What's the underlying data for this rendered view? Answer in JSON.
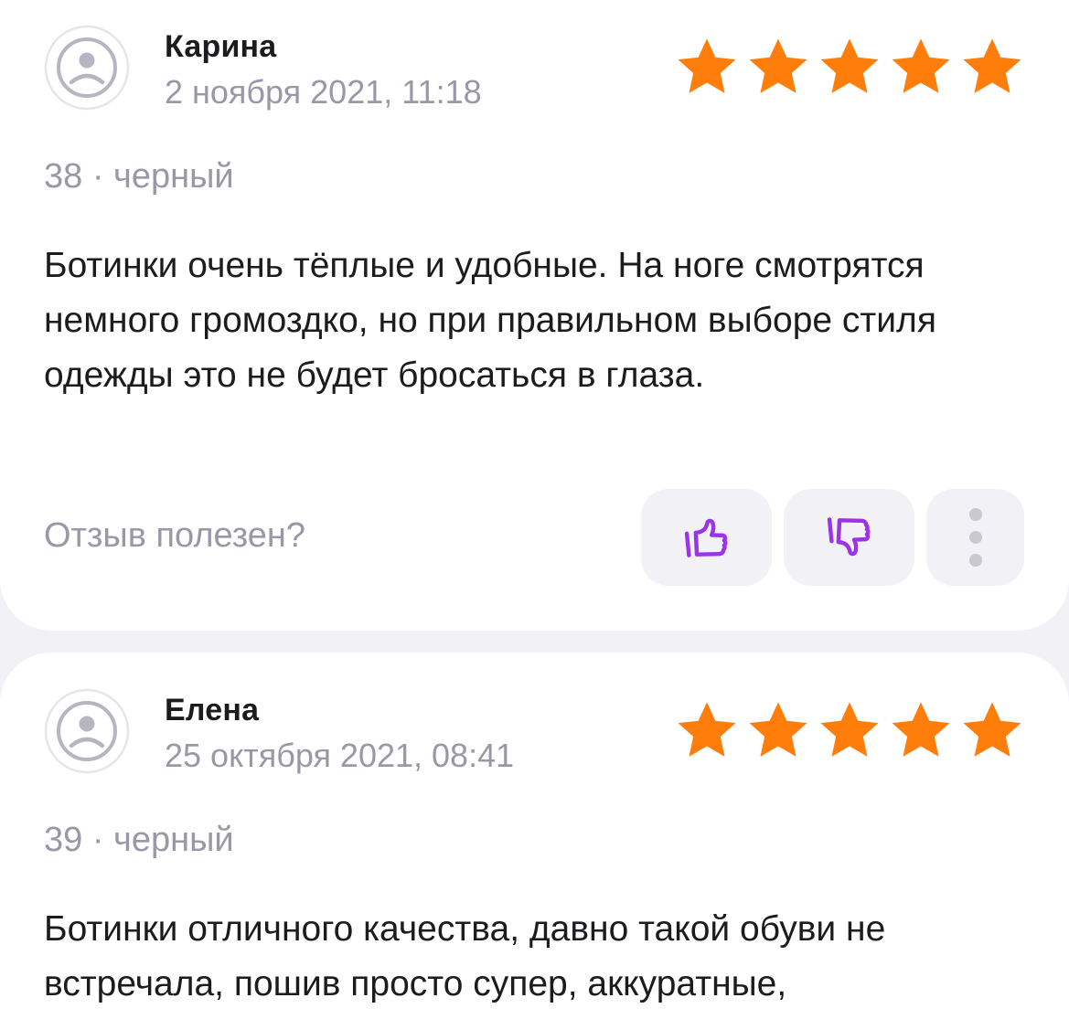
{
  "colors": {
    "star": "#ff7d0a",
    "accent": "#9b34e8",
    "muted_text": "#9a98a6",
    "text": "#1c1c1e",
    "background": "#f2f2f6"
  },
  "reviews": [
    {
      "author": "Карина",
      "date": "2 ноября 2021, 11:18",
      "rating": 5,
      "variant": "38 · черный",
      "text": "Ботинки очень тёплые и удобные. На ноге смотрятся немного громоздко, но при правильном выборе стиля одежды это не будет бросаться в глаза.",
      "helpful_label": "Отзыв полезен?",
      "avatar_icon": "sad-face-icon",
      "like_icon": "thumbs-up-icon",
      "dislike_icon": "thumbs-down-icon",
      "more_icon": "more-vertical-icon"
    },
    {
      "author": "Елена",
      "date": "25 октября 2021, 08:41",
      "rating": 5,
      "variant": "39 · черный",
      "text": "Ботинки отличного качества, давно такой обуви не встречала, пошив просто супер, аккуратные,",
      "avatar_icon": "sad-face-icon"
    }
  ]
}
